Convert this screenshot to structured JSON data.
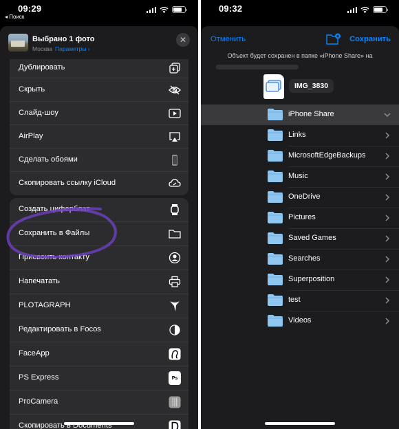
{
  "left": {
    "status": {
      "time": "09:29",
      "back_label": "◂ Поиск"
    },
    "share_header": {
      "title": "Выбрано 1 фото",
      "location": "Москва",
      "options_label": "Параметры ›",
      "close_icon": "close-icon"
    },
    "group1": [
      {
        "label": "Дублировать",
        "icon": "duplicate-icon"
      },
      {
        "label": "Скрыть",
        "icon": "hide-eye-icon"
      },
      {
        "label": "Слайд-шоу",
        "icon": "play-icon"
      },
      {
        "label": "AirPlay",
        "icon": "airplay-icon"
      },
      {
        "label": "Сделать обоями",
        "icon": "phone-icon"
      },
      {
        "label": "Скопировать ссылку iCloud",
        "icon": "link-icon"
      }
    ],
    "group2": [
      {
        "label": "Создать циферблат",
        "icon": "watch-icon"
      },
      {
        "label": "Сохранить в Файлы",
        "icon": "folder-icon"
      },
      {
        "label": "Присвоить контакту",
        "icon": "contact-icon"
      },
      {
        "label": "Напечатать",
        "icon": "printer-icon"
      },
      {
        "label": "PLOTAGRAPH",
        "icon": "plotagraph-icon"
      },
      {
        "label": "Редактировать в Focos",
        "icon": "focos-icon"
      },
      {
        "label": "FaceApp",
        "icon": "faceapp-icon"
      },
      {
        "label": "PS Express",
        "icon": "ps-express-icon",
        "badge": "Ps"
      },
      {
        "label": "ProCamera",
        "icon": "procamera-icon"
      },
      {
        "label": "Скопировать в Documents",
        "icon": "documents-icon"
      }
    ],
    "annotation_color": "#6b3fb8"
  },
  "right": {
    "status": {
      "time": "09:32"
    },
    "nav": {
      "cancel": "Отменить",
      "save": "Сохранить"
    },
    "save_note": "Объект будет сохранен в папке «iPhone Share» на",
    "file_name": "IMG_3830",
    "folders": [
      {
        "name": "iPhone Share",
        "selected": true
      },
      {
        "name": "Links"
      },
      {
        "name": "MicrosoftEdgeBackups"
      },
      {
        "name": "Music"
      },
      {
        "name": "OneDrive"
      },
      {
        "name": "Pictures"
      },
      {
        "name": "Saved Games"
      },
      {
        "name": "Searches"
      },
      {
        "name": "Superposition"
      },
      {
        "name": "test"
      },
      {
        "name": "Videos"
      }
    ],
    "accent": "#0a84ff",
    "folder_color": "#8ec6f0"
  }
}
